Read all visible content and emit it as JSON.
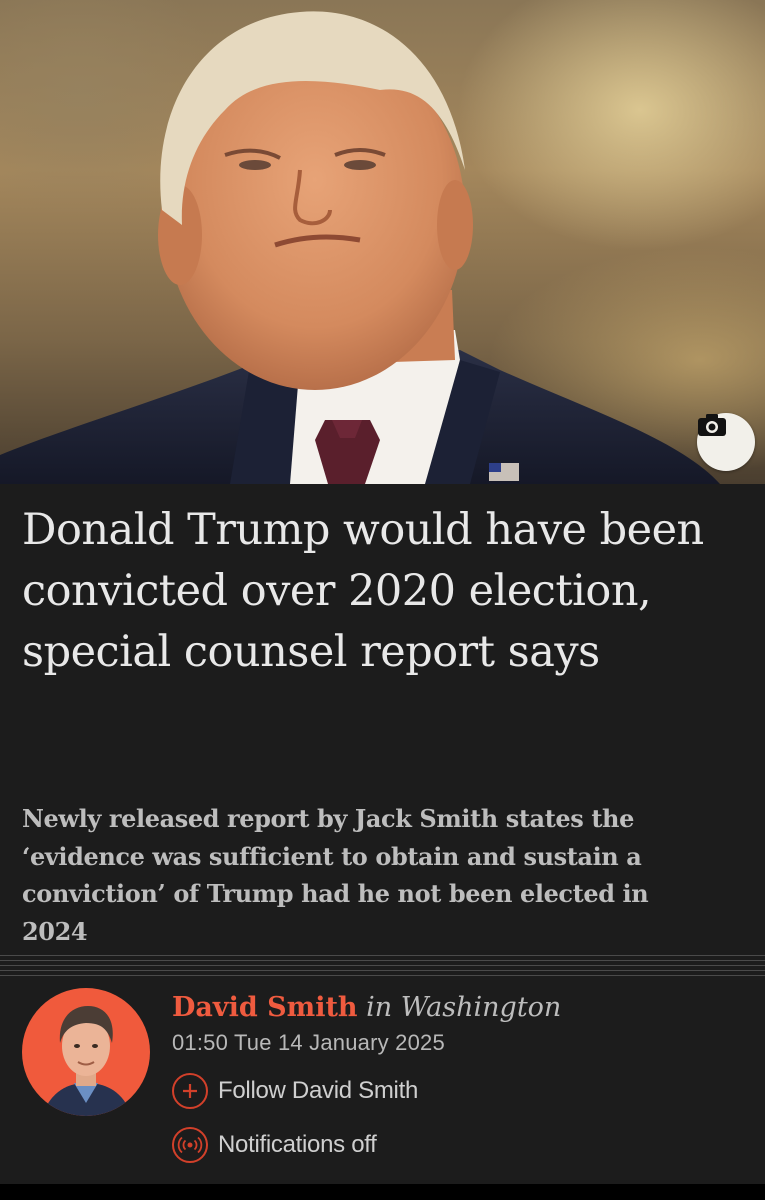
{
  "article": {
    "headline": "Donald Trump would have been convicted over 2020 election, special counsel report says",
    "standfirst": "Newly released report by Jack Smith states the ‘evidence was sufficient to obtain and sustain a conviction’ of Trump had he not been elected in 2024"
  },
  "byline": {
    "author": "David Smith",
    "location": "in Washington",
    "timestamp": "01:50 Tue 14 January 2025",
    "follow_label": "Follow David Smith",
    "notifications_label": "Notifications off"
  },
  "icons": {
    "camera": "camera-icon",
    "follow": "plus-icon",
    "notifications": "broadcast-icon"
  },
  "colors": {
    "background": "#1c1c1c",
    "accent": "#ef5b3f",
    "headline": "#e8e8e8",
    "standfirst": "#bdbdbd"
  }
}
